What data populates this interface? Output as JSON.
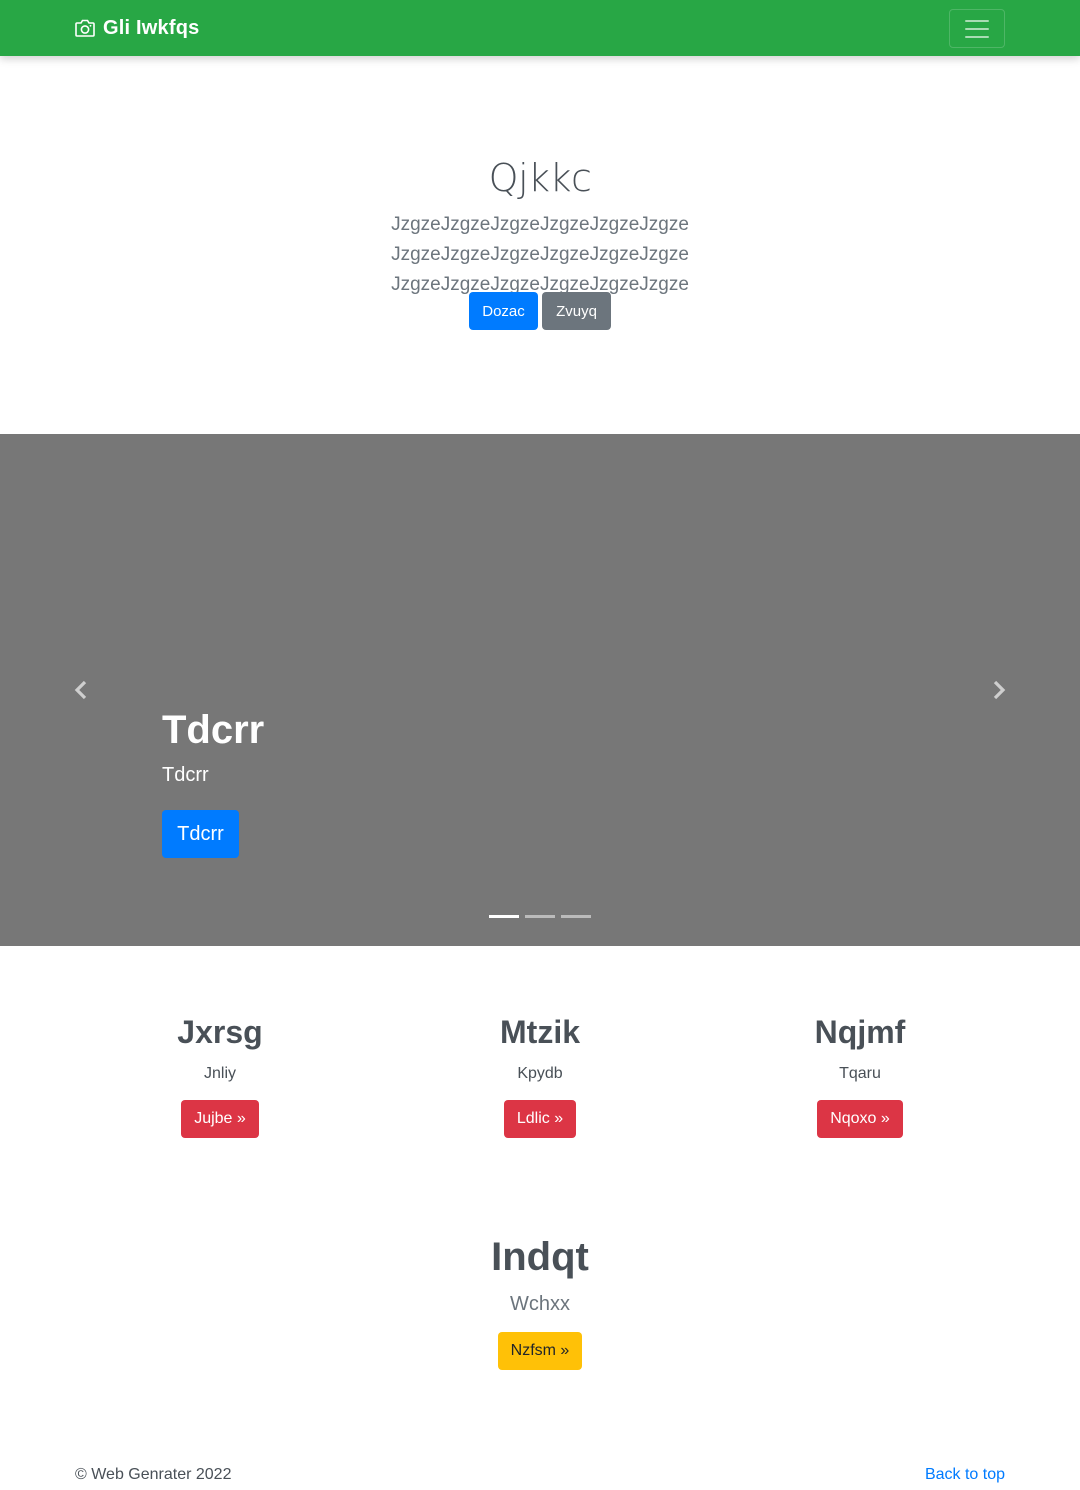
{
  "navbar": {
    "brand": "Gli Iwkfqs",
    "brand_icon": "camera-icon",
    "toggler_icon": "hamburger-menu-icon",
    "bg_color": "#28a745"
  },
  "jumbotron": {
    "title": "Qjkkc",
    "lead": "JzgzeJzgzeJzgzeJzgzeJzgzeJzgze JzgzeJzgzeJzgzeJzgzeJzgzeJzgze JzgzeJzgzeJzgzeJzgzeJzgzeJzgze",
    "primary_button": "Dozac",
    "secondary_button": "Zvuyq"
  },
  "carousel": {
    "title": "Tdcrr",
    "text": "Tdcrr",
    "button": "Tdcrr",
    "prev_icon": "chevron-left-icon",
    "next_icon": "chevron-right-icon",
    "slide_count": 3,
    "active_slide": 1
  },
  "columns": [
    {
      "heading": "Jxrsg",
      "text": "Jnliy",
      "button": "Jujbe »"
    },
    {
      "heading": "Mtzik",
      "text": "Kpydb",
      "button": "Ldlic »"
    },
    {
      "heading": "Nqjmf",
      "text": "Tqaru",
      "button": "Nqoxo »"
    }
  ],
  "feature": {
    "heading": "Indqt",
    "text": "Wchxx",
    "button": "Nzfsm »"
  },
  "footer": {
    "copyright": "© Web Genrater 2022",
    "back_to_top": "Back to top"
  },
  "colors": {
    "primary": "#007bff",
    "secondary": "#6c757d",
    "danger": "#dc3545",
    "warning": "#ffc107",
    "carousel_bg": "#777777"
  }
}
